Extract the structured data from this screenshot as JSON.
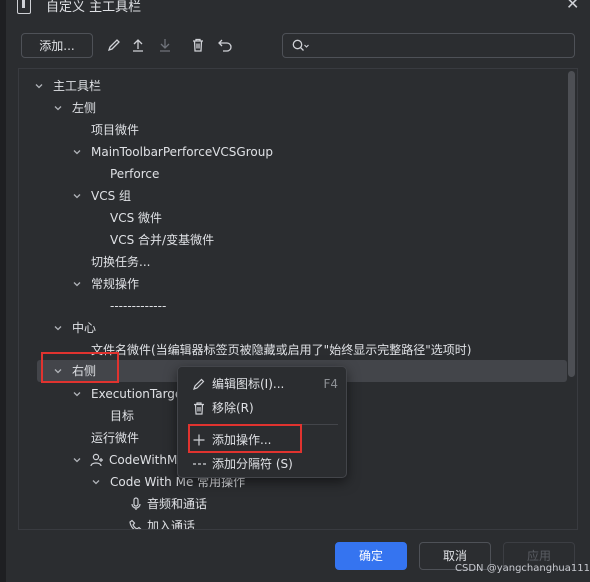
{
  "window": {
    "title": "自定义 主工具栏"
  },
  "toolbar": {
    "add_label": "添加...",
    "search_placeholder": ""
  },
  "tree": {
    "rows": [
      {
        "label": "主工具栏",
        "chevron": "down"
      },
      {
        "label": "左侧",
        "chevron": "down"
      },
      {
        "label": "项目微件",
        "chevron": ""
      },
      {
        "label": "MainToolbarPerforceVCSGroup",
        "chevron": "down"
      },
      {
        "label": "Perforce",
        "chevron": ""
      },
      {
        "label": "VCS 组",
        "chevron": "down"
      },
      {
        "label": "VCS 微件",
        "chevron": ""
      },
      {
        "label": "VCS 合并/变基微件",
        "chevron": ""
      },
      {
        "label": "切换任务...",
        "chevron": ""
      },
      {
        "label": "常规操作",
        "chevron": "down"
      },
      {
        "label": "-------------",
        "chevron": ""
      },
      {
        "label": "中心",
        "chevron": "down"
      },
      {
        "label": "文件名微件(当编辑器标签页被隐藏或启用了\"始终显示完整路径\"选项时)",
        "chevron": ""
      },
      {
        "label": "右侧",
        "chevron": "down"
      },
      {
        "label": "ExecutionTarge",
        "chevron": "down"
      },
      {
        "label": "目标",
        "chevron": ""
      },
      {
        "label": "运行微件",
        "chevron": ""
      },
      {
        "label": "CodeWithM",
        "chevron": "down",
        "icon": "user-plus-icon"
      },
      {
        "label": "Code With Me 常用操作",
        "chevron": "down"
      },
      {
        "label": "音频和通话",
        "chevron": "",
        "icon": "microphone-icon"
      },
      {
        "label": "加入通话",
        "chevron": "",
        "icon": "phone-icon"
      }
    ]
  },
  "context_menu": {
    "items": [
      {
        "label": "编辑图标(I)...",
        "shortcut": "F4",
        "icon": "pencil-icon"
      },
      {
        "label": "移除(R)",
        "shortcut": "",
        "icon": "trash-icon"
      },
      {
        "label": "添加操作...",
        "shortcut": "",
        "icon": "plus-icon"
      },
      {
        "label": "添加分隔符 (S)",
        "shortcut": "",
        "icon": "separator-icon"
      }
    ]
  },
  "footer": {
    "ok_label": "确定",
    "cancel_label": "取消",
    "apply_label": "应用"
  },
  "watermark": "CSDN @yangchanghua111",
  "colors": {
    "accent": "#3574f0",
    "highlight": "#e0332f",
    "background": "#2b2d30"
  }
}
